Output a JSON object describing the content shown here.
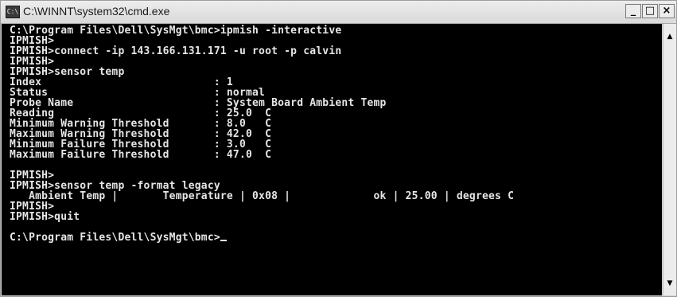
{
  "window": {
    "title": "C:\\WINNT\\system32\\cmd.exe",
    "icon": "cmd-icon",
    "buttons": {
      "minimize": "_",
      "maximize": "□",
      "close": "×"
    }
  },
  "console": {
    "lines": [
      "C:\\Program Files\\Dell\\SysMgt\\bmc>ipmish -interactive",
      "IPMISH>",
      "IPMISH>connect -ip 143.166.131.171 -u root -p calvin",
      "IPMISH>",
      "IPMISH>sensor temp",
      "Index                           : 1",
      "Status                          : normal",
      "Probe Name                      : System Board Ambient Temp",
      "Reading                         : 25.0  C",
      "Minimum Warning Threshold       : 8.0   C",
      "Maximum Warning Threshold       : 42.0  C",
      "Minimum Failure Threshold       : 3.0   C",
      "Maximum Failure Threshold       : 47.0  C",
      "",
      "IPMISH>",
      "IPMISH>sensor temp -format legacy",
      "   Ambient Temp |       Temperature | 0x08 |             ok | 25.00 | degrees C",
      "IPMISH>",
      "IPMISH>quit",
      "",
      "C:\\Program Files\\Dell\\SysMgt\\bmc>"
    ]
  },
  "scrollbar": {
    "up_arrow": "▲",
    "down_arrow": "▼"
  }
}
